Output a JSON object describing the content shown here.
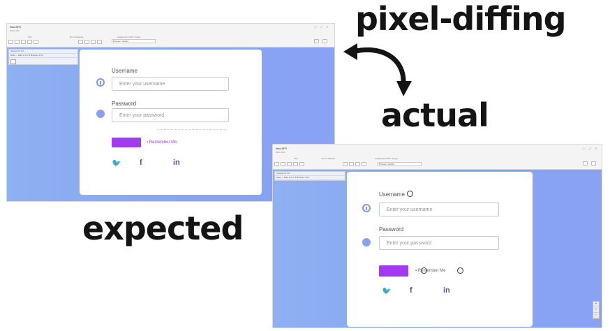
{
  "captions": {
    "top": "pixel-diffing",
    "middle": "actual",
    "bottom": "expected"
  },
  "app": {
    "title": "Iliad APS",
    "subtitle": "Rider Utils",
    "toolbar_labels": [
      "Title",
      "Run & Results",
      "Assignment URL / Target"
    ],
    "url_value": "Browser: Webkit"
  },
  "side_panel": {
    "header": "Viewport ▾ 1.0",
    "row": "Date — Map  1 Gr.1 ▾ Browser  1.0 ▾"
  },
  "form": {
    "username_label": "Username",
    "username_placeholder": "Enter your username",
    "password_label": "Password",
    "password_placeholder": "Enter your password",
    "remember_text": "Remember Me"
  },
  "social": {
    "twitter": "🐦",
    "facebook": "f",
    "linkedin": "in"
  },
  "colors": {
    "accent": "#a23af2",
    "stage": "#8aa6f2",
    "icon": "#7f95ee"
  }
}
